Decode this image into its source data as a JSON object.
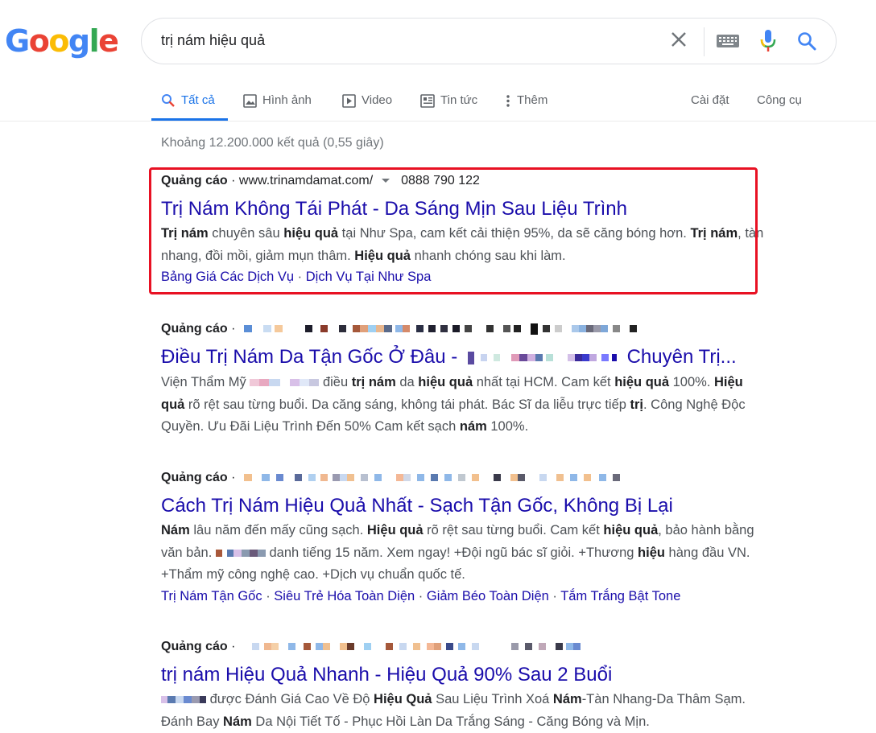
{
  "logo": "Google",
  "search": {
    "query": "trị nám hiệu quả"
  },
  "tabs": [
    {
      "label": "Tất cả"
    },
    {
      "label": "Hình ảnh"
    },
    {
      "label": "Video"
    },
    {
      "label": "Tin tức"
    },
    {
      "label": "Thêm"
    }
  ],
  "tools": {
    "settings": "Cài đặt",
    "tools": "Công cụ"
  },
  "stats": "Khoảng 12.200.000 kết quả (0,55 giây)",
  "ads": [
    {
      "label": "Quảng cáo",
      "url": "www.trinamdamat.com/",
      "phone": "0888 790 122",
      "title": "Trị Nám Không Tái Phát - Da Sáng Mịn Sau Liệu Trình",
      "sitelinks": [
        "Bảng Giá Các Dịch Vụ",
        "Dịch Vụ Tại Như Spa"
      ]
    },
    {
      "label": "Quảng cáo",
      "title_start": "Điều Trị Nám Da Tận Gốc Ở Đâu - ",
      "title_end": "Chuyên Trị..."
    },
    {
      "label": "Quảng cáo",
      "title": "Cách Trị Nám Hiệu Quả Nhất - Sạch Tận Gốc, Không Bị Lại",
      "sitelinks": [
        "Trị Nám Tận Gốc",
        "Siêu Trẻ Hóa Toàn Diện",
        "Giảm Béo Toàn Diện",
        "Tắm Trắng Bật Tone"
      ]
    },
    {
      "label": "Quảng cáo",
      "title": "trị nám Hiệu Quả Nhanh - Hiệu Quả 90% Sau 2 Buổi"
    }
  ],
  "colors": {
    "link": "#1a0dab",
    "accent": "#1a73e8",
    "highlight": "#e81123"
  }
}
